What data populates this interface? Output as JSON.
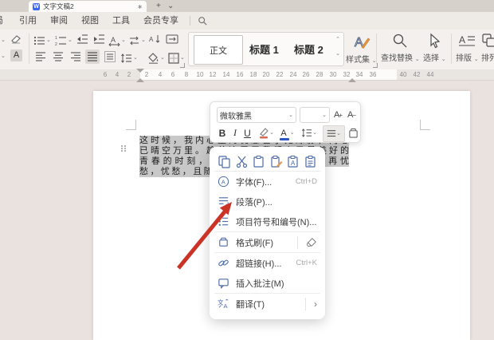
{
  "window": {
    "tab_title": "文字文稿2",
    "modified_dot": "∗",
    "new_tab_label": "+",
    "tab_list_chevron": "⌄"
  },
  "menubar": {
    "clipped_item": "局",
    "items": [
      "引用",
      "审阅",
      "视图",
      "工具",
      "会员专享"
    ]
  },
  "ribbon": {
    "styles": {
      "normal": "正文",
      "heading1": "标题 1",
      "heading2": "标题 2"
    },
    "style_set_label": "样式集",
    "find_replace_label": "查找替换",
    "select_label": "选择",
    "typeset_label": "排版",
    "arrange_label": "排列"
  },
  "ruler": {
    "left": [
      "6",
      "4",
      "2"
    ],
    "center": [
      "2",
      "4",
      "6",
      "8",
      "10",
      "12",
      "14",
      "16",
      "18",
      "20",
      "22",
      "24",
      "26",
      "28",
      "30",
      "32",
      "34",
      "36"
    ],
    "right": [
      "40",
      "42",
      "44"
    ]
  },
  "document": {
    "lines": [
      "这时候，我内心里的忧愁已了无踪影，内心",
      "已晴空万里。趁着这属于我们自己最美好的",
      "青春的时刻，去做自己想做的事。不再忧",
      "愁，忧愁，且随风去。"
    ]
  },
  "mini_toolbar": {
    "font_name": "微软雅黑",
    "font_size": "",
    "bold": "B",
    "italic": "I",
    "underline": "U",
    "grow_letter": "A",
    "grow_sign": "+",
    "shrink_letter": "A",
    "shrink_sign": "−",
    "font_color_letter": "A"
  },
  "context_menu": {
    "items": {
      "font": {
        "label": "字体(F)...",
        "shortcut": "Ctrl+D"
      },
      "paragraph": {
        "label": "段落(P)..."
      },
      "bullets": {
        "label": "项目符号和编号(N)..."
      },
      "format_painter": {
        "label": "格式刷(F)"
      },
      "hyperlink": {
        "label": "超链接(H)...",
        "shortcut": "Ctrl+K"
      },
      "comment": {
        "label": "插入批注(M)"
      },
      "translate": {
        "label": "翻译(T)",
        "submenu_arrow": "›"
      }
    }
  },
  "colors": {
    "accent_blue": "#3a66f4",
    "icon_blue": "#4c6ba8",
    "selection_gray": "#c8c8c8",
    "arrow_red": "#cb3327"
  }
}
